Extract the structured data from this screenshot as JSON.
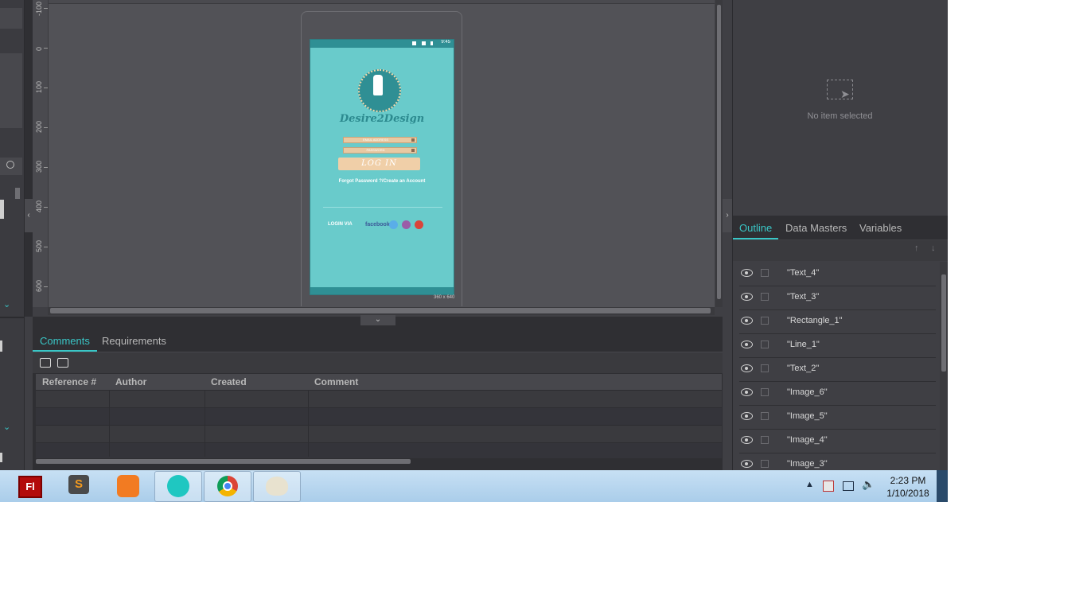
{
  "ruler": {
    "labels": [
      "-100",
      "0",
      "100",
      "200",
      "300",
      "400",
      "500",
      "600"
    ]
  },
  "mockup": {
    "status_time": "9:45",
    "brand": "Desire2Design",
    "email_placeholder": "EMAIL ADDRESS",
    "password_placeholder": "PASSWORD",
    "login_button": "LOG IN",
    "forgot_link": "Forgot Password ?/Create an Account",
    "login_via": "LOGIN VIA",
    "facebook": "facebook",
    "social_icons": [
      "twitter-icon",
      "instagram-icon",
      "google-plus-icon"
    ],
    "dimensions": "360 x 640",
    "colors": {
      "background": "#69cbcb",
      "bar": "#2f8f94",
      "button": "#f0cfa8"
    }
  },
  "bottom_panel": {
    "tabs": [
      "Comments",
      "Requirements"
    ],
    "active_tab": "Comments",
    "table": {
      "columns": [
        "Reference #",
        "Author",
        "Created",
        "Comment"
      ],
      "rows": []
    }
  },
  "right_panel": {
    "no_selection": "No item selected",
    "tabs": [
      "Outline",
      "Data Masters",
      "Variables"
    ],
    "active_tab": "Outline",
    "outline": [
      "\"Text_4\"",
      "\"Text_3\"",
      "\"Rectangle_1\"",
      "\"Line_1\"",
      "\"Text_2\"",
      "\"Image_6\"",
      "\"Image_5\"",
      "\"Image_4\"",
      "\"Image_3\""
    ]
  },
  "taskbar": {
    "apps": [
      "flash-icon",
      "sublime-icon",
      "xampp-icon",
      "axure-icon",
      "chrome-icon",
      "paint-icon"
    ],
    "time": "2:23 PM",
    "date": "1/10/2018",
    "accent": "#39c6c6"
  }
}
